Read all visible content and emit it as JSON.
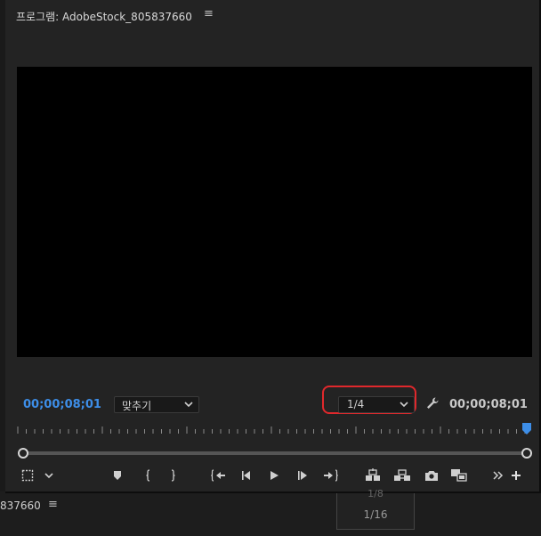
{
  "panel": {
    "title": "프로그램: AdobeStock_805837660",
    "menu_icon": "≡"
  },
  "timecode": {
    "current": "00;00;08;01",
    "duration": "00;00;08;01"
  },
  "zoom_dropdown": {
    "selected": "맞추기"
  },
  "resolution_dropdown": {
    "selected": "1/4"
  },
  "icons": {
    "wrench": "wrench-icon",
    "marker": "marker-icon",
    "in": "mark-in-icon",
    "out": "mark-out-icon",
    "go_in": "go-to-in-icon",
    "step_back": "step-back-icon",
    "play": "play-icon",
    "step_forward": "step-forward-icon",
    "go_out": "go-to-out-icon",
    "lift": "lift-icon",
    "extract": "extract-icon",
    "export_frame": "camera-icon",
    "compare": "comparison-view-icon",
    "more": "more-icon",
    "add": "add-button-icon"
  },
  "colors": {
    "timecode_active": "#3d8ee8",
    "highlight": "#e0282c",
    "playhead": "#3d8ee8"
  },
  "lower_panel": {
    "title": "837660",
    "menu_icon": "≡",
    "popup_prev": "1/8",
    "popup_item": "1/16"
  }
}
